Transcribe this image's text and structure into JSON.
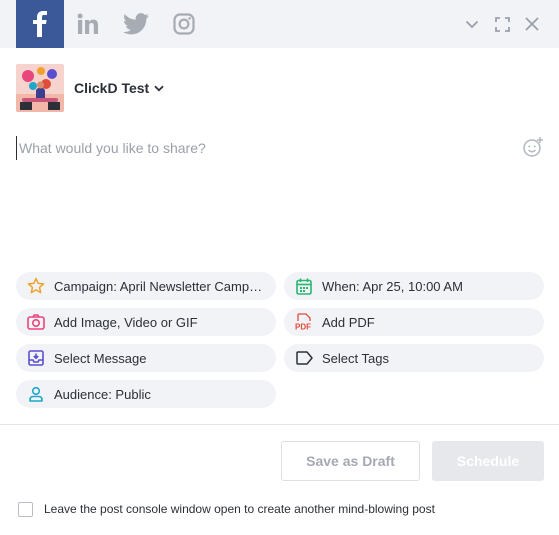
{
  "networks": [
    {
      "name": "facebook",
      "icon": "facebook-icon",
      "active": true
    },
    {
      "name": "linkedin",
      "icon": "linkedin-icon",
      "active": false
    },
    {
      "name": "twitter",
      "icon": "twitter-icon",
      "active": false
    },
    {
      "name": "instagram",
      "icon": "instagram-icon",
      "active": false
    }
  ],
  "window_controls": [
    "chevron-down-icon",
    "expand-icon",
    "close-icon"
  ],
  "account": {
    "name": "ClickD Test",
    "avatar_icon": "avatar"
  },
  "composer": {
    "placeholder": "What would you like to share?",
    "value": ""
  },
  "options": {
    "campaign": {
      "label": "Campaign: April Newsletter Campaign",
      "icon": "star-icon"
    },
    "when": {
      "label": "When: Apr 25, 10:00 AM",
      "icon": "calendar-icon"
    },
    "media": {
      "label": "Add Image, Video or GIF",
      "icon": "camera-icon"
    },
    "pdf": {
      "label": "Add PDF",
      "icon": "pdf-icon"
    },
    "message": {
      "label": "Select Message",
      "icon": "inbox-icon"
    },
    "tags": {
      "label": "Select Tags",
      "icon": "tag-icon"
    },
    "audience": {
      "label": "Audience: Public",
      "icon": "user-icon"
    }
  },
  "actions": {
    "save_draft": "Save as Draft",
    "schedule": "Schedule"
  },
  "keep_open": {
    "label": "Leave the post console window open to create another mind-blowing post",
    "checked": false
  },
  "colors": {
    "facebook": "#3b5998",
    "campaign_star": "#f0a22e",
    "calendar": "#2bb673",
    "media": "#e8467c",
    "pdf": "#e04b3a",
    "message": "#5a4fcf",
    "audience": "#1fa7c9",
    "inactive_network": "#a7abb4"
  }
}
